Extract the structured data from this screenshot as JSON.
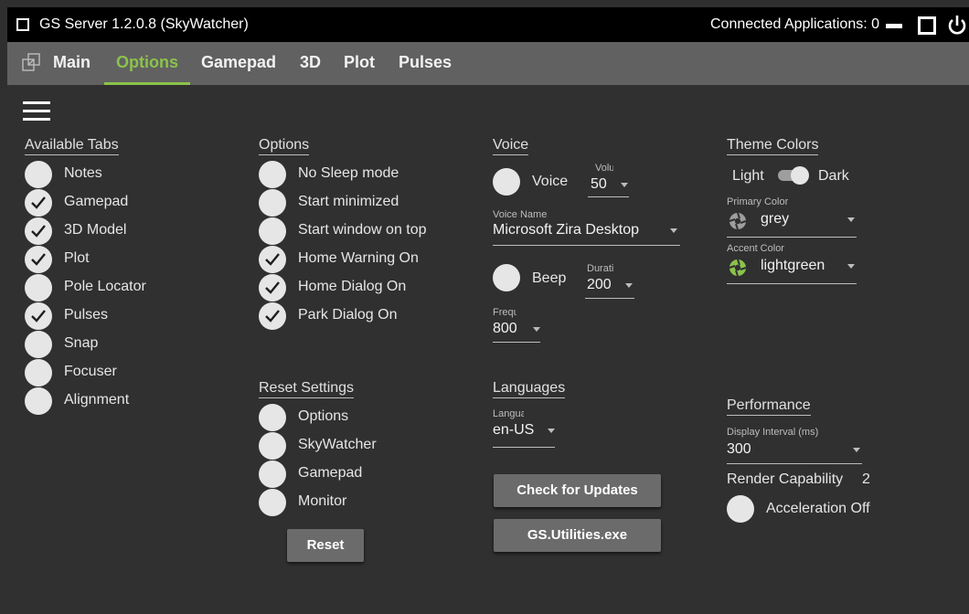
{
  "window": {
    "title": "GS Server 1.2.0.8 (SkyWatcher)",
    "connected": "Connected Applications: 0"
  },
  "tabs": [
    "Main",
    "Options",
    "Gamepad",
    "3D",
    "Plot",
    "Pulses"
  ],
  "active_tab": "Options",
  "available_tabs": {
    "title": "Available Tabs",
    "items": [
      {
        "label": "Notes",
        "checked": false
      },
      {
        "label": "Gamepad",
        "checked": true
      },
      {
        "label": "3D Model",
        "checked": true
      },
      {
        "label": "Plot",
        "checked": true
      },
      {
        "label": "Pole Locator",
        "checked": false
      },
      {
        "label": "Pulses",
        "checked": true
      },
      {
        "label": "Snap",
        "checked": false
      },
      {
        "label": "Focuser",
        "checked": false
      },
      {
        "label": "Alignment",
        "checked": false
      }
    ]
  },
  "options": {
    "title": "Options",
    "items": [
      {
        "label": "No Sleep mode",
        "checked": false
      },
      {
        "label": "Start minimized",
        "checked": false
      },
      {
        "label": "Start window on top",
        "checked": false
      },
      {
        "label": "Home Warning On",
        "checked": true
      },
      {
        "label": "Home Dialog On",
        "checked": true
      },
      {
        "label": "Park Dialog On",
        "checked": true
      }
    ]
  },
  "reset": {
    "title": "Reset Settings",
    "items": [
      {
        "label": "Options",
        "checked": false
      },
      {
        "label": "SkyWatcher",
        "checked": false
      },
      {
        "label": "Gamepad",
        "checked": false
      },
      {
        "label": "Monitor",
        "checked": false
      }
    ],
    "button": "Reset"
  },
  "voice": {
    "title": "Voice",
    "voice_label": "Voice",
    "volume_caption": "Volu",
    "volume": "50",
    "voice_name_caption": "Voice Name",
    "voice_name": "Microsoft Zira Desktop",
    "beep_label": "Beep",
    "duration_caption": "Durati",
    "duration": "200",
    "frequency_caption": "Frequ",
    "frequency": "800"
  },
  "languages": {
    "title": "Languages",
    "caption": "Languag",
    "value": "en-US"
  },
  "buttons": {
    "check_updates": "Check for Updates",
    "utilities": "GS.Utilities.exe"
  },
  "theme": {
    "title": "Theme Colors",
    "light": "Light",
    "dark": "Dark",
    "dark_mode": true,
    "primary_caption": "Primary Color",
    "primary": "grey",
    "primary_hex": "#9e9e9e",
    "accent_caption": "Accent Color",
    "accent": "lightgreen",
    "accent_hex": "#8bc34a"
  },
  "performance": {
    "title": "Performance",
    "interval_caption": "Display Interval (ms)",
    "interval": "300",
    "render_label": "Render Capability",
    "render_value": "2",
    "acceleration_label": "Acceleration Off",
    "acceleration_checked": false
  }
}
